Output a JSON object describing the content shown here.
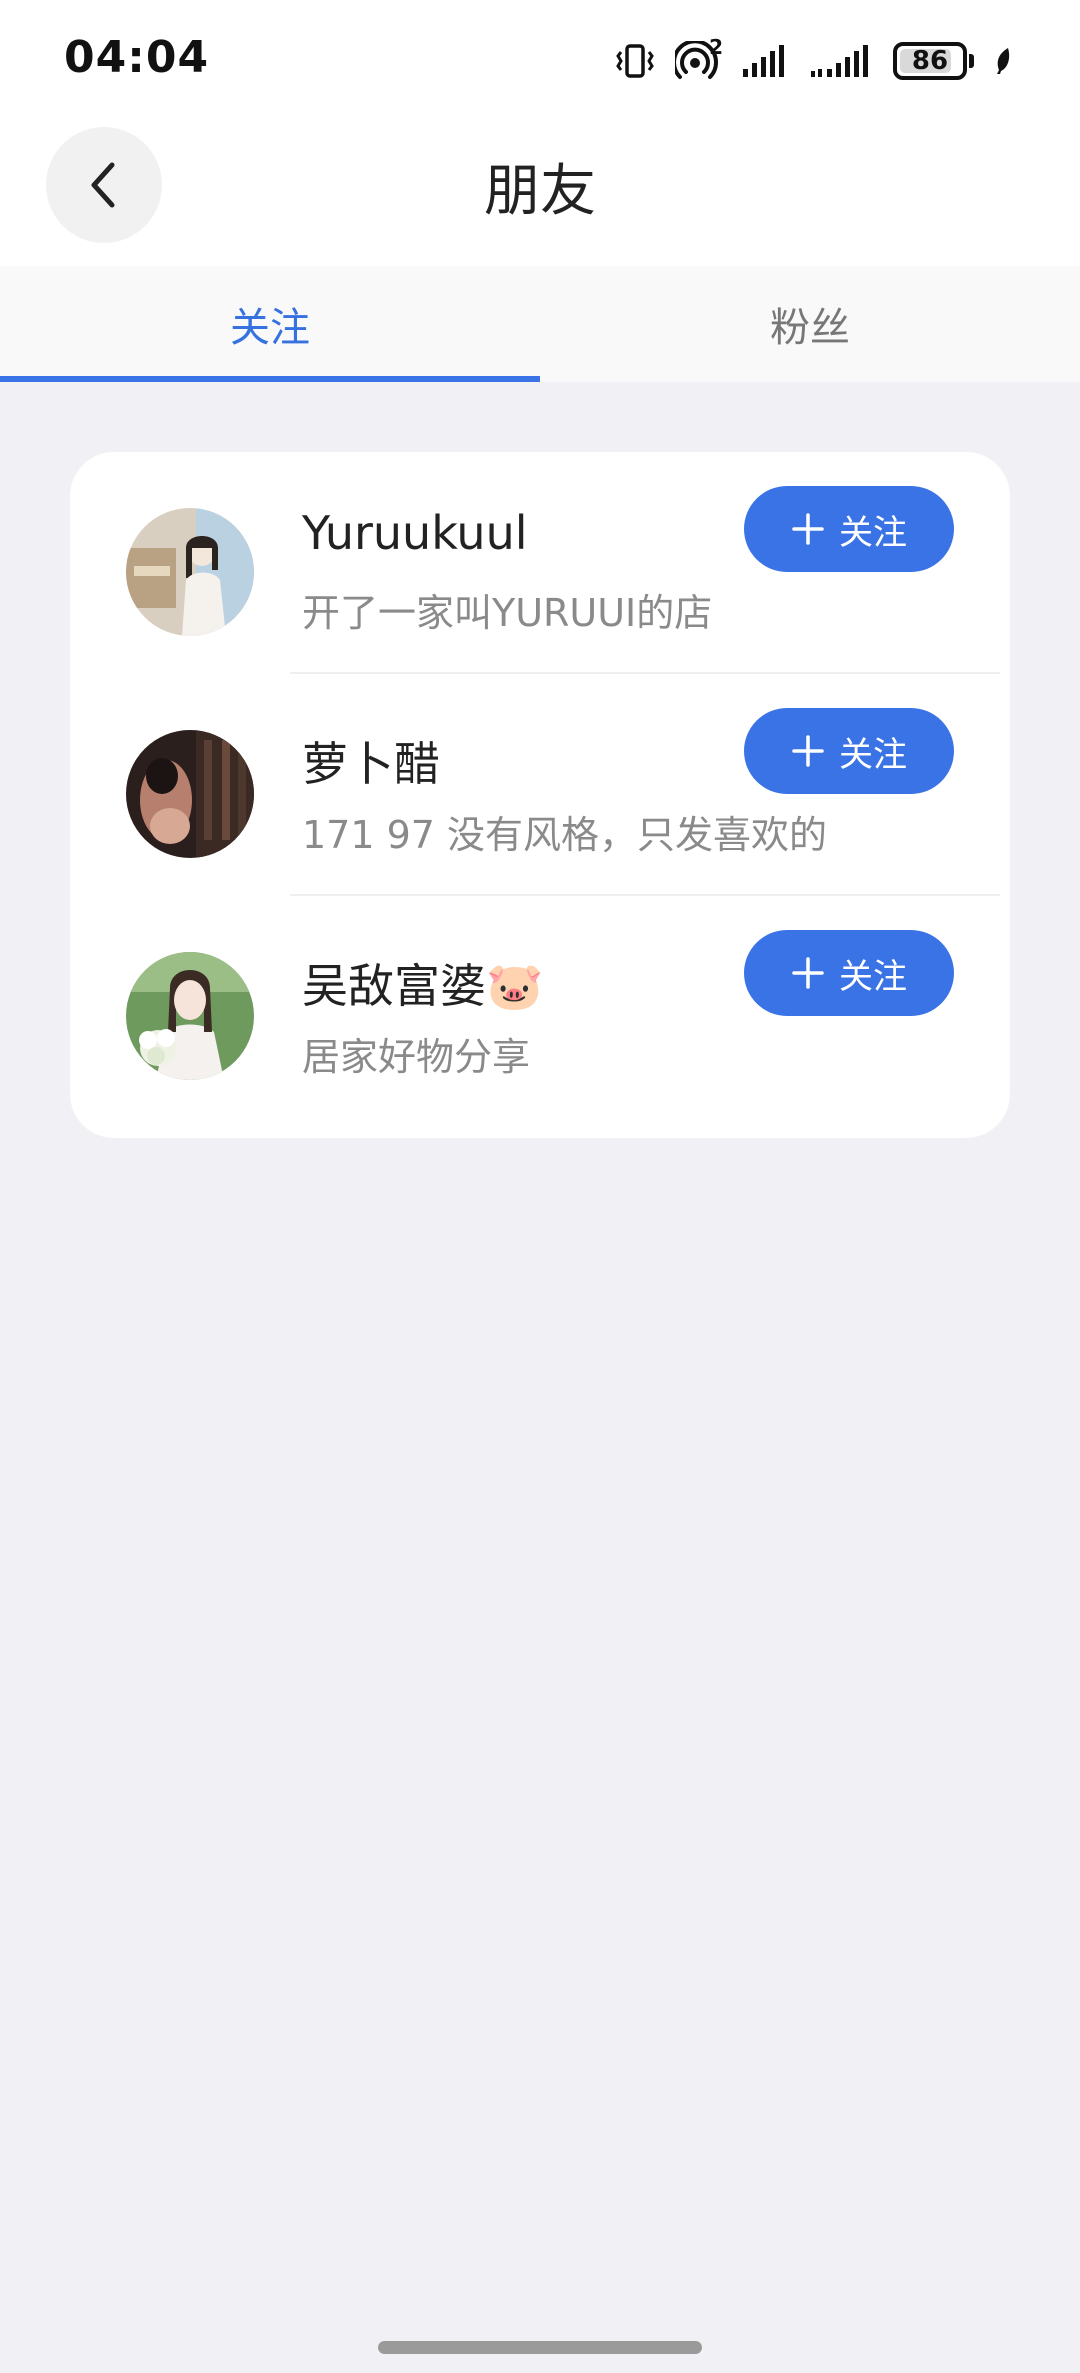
{
  "status_bar": {
    "time": "04:04",
    "battery": "86",
    "battery_level": 0.86,
    "hotspot_count": "2",
    "icons": [
      "vibrate-icon",
      "hotspot-icon",
      "signal-icon",
      "signal-icon",
      "battery-icon",
      "leaf-icon"
    ]
  },
  "header": {
    "back_icon": "chevron-left-icon",
    "title": "朋友"
  },
  "tabs": [
    {
      "label": "关注",
      "active": true
    },
    {
      "label": "粉丝",
      "active": false
    }
  ],
  "follow_list": [
    {
      "name": "Yuruukuul",
      "description": "开了一家叫YURUUI的店",
      "button_label": "关注"
    },
    {
      "name": "萝卜醋",
      "description": "171 97 没有风格，只发喜欢的",
      "button_label": "关注"
    },
    {
      "name": "吴敌富婆🐷",
      "description": "居家好物分享",
      "button_label": "关注"
    }
  ],
  "colors": {
    "accent": "#3a73e6",
    "background": "#f0f0f5",
    "card": "#ffffff",
    "secondary_text": "#8a8a8a"
  }
}
